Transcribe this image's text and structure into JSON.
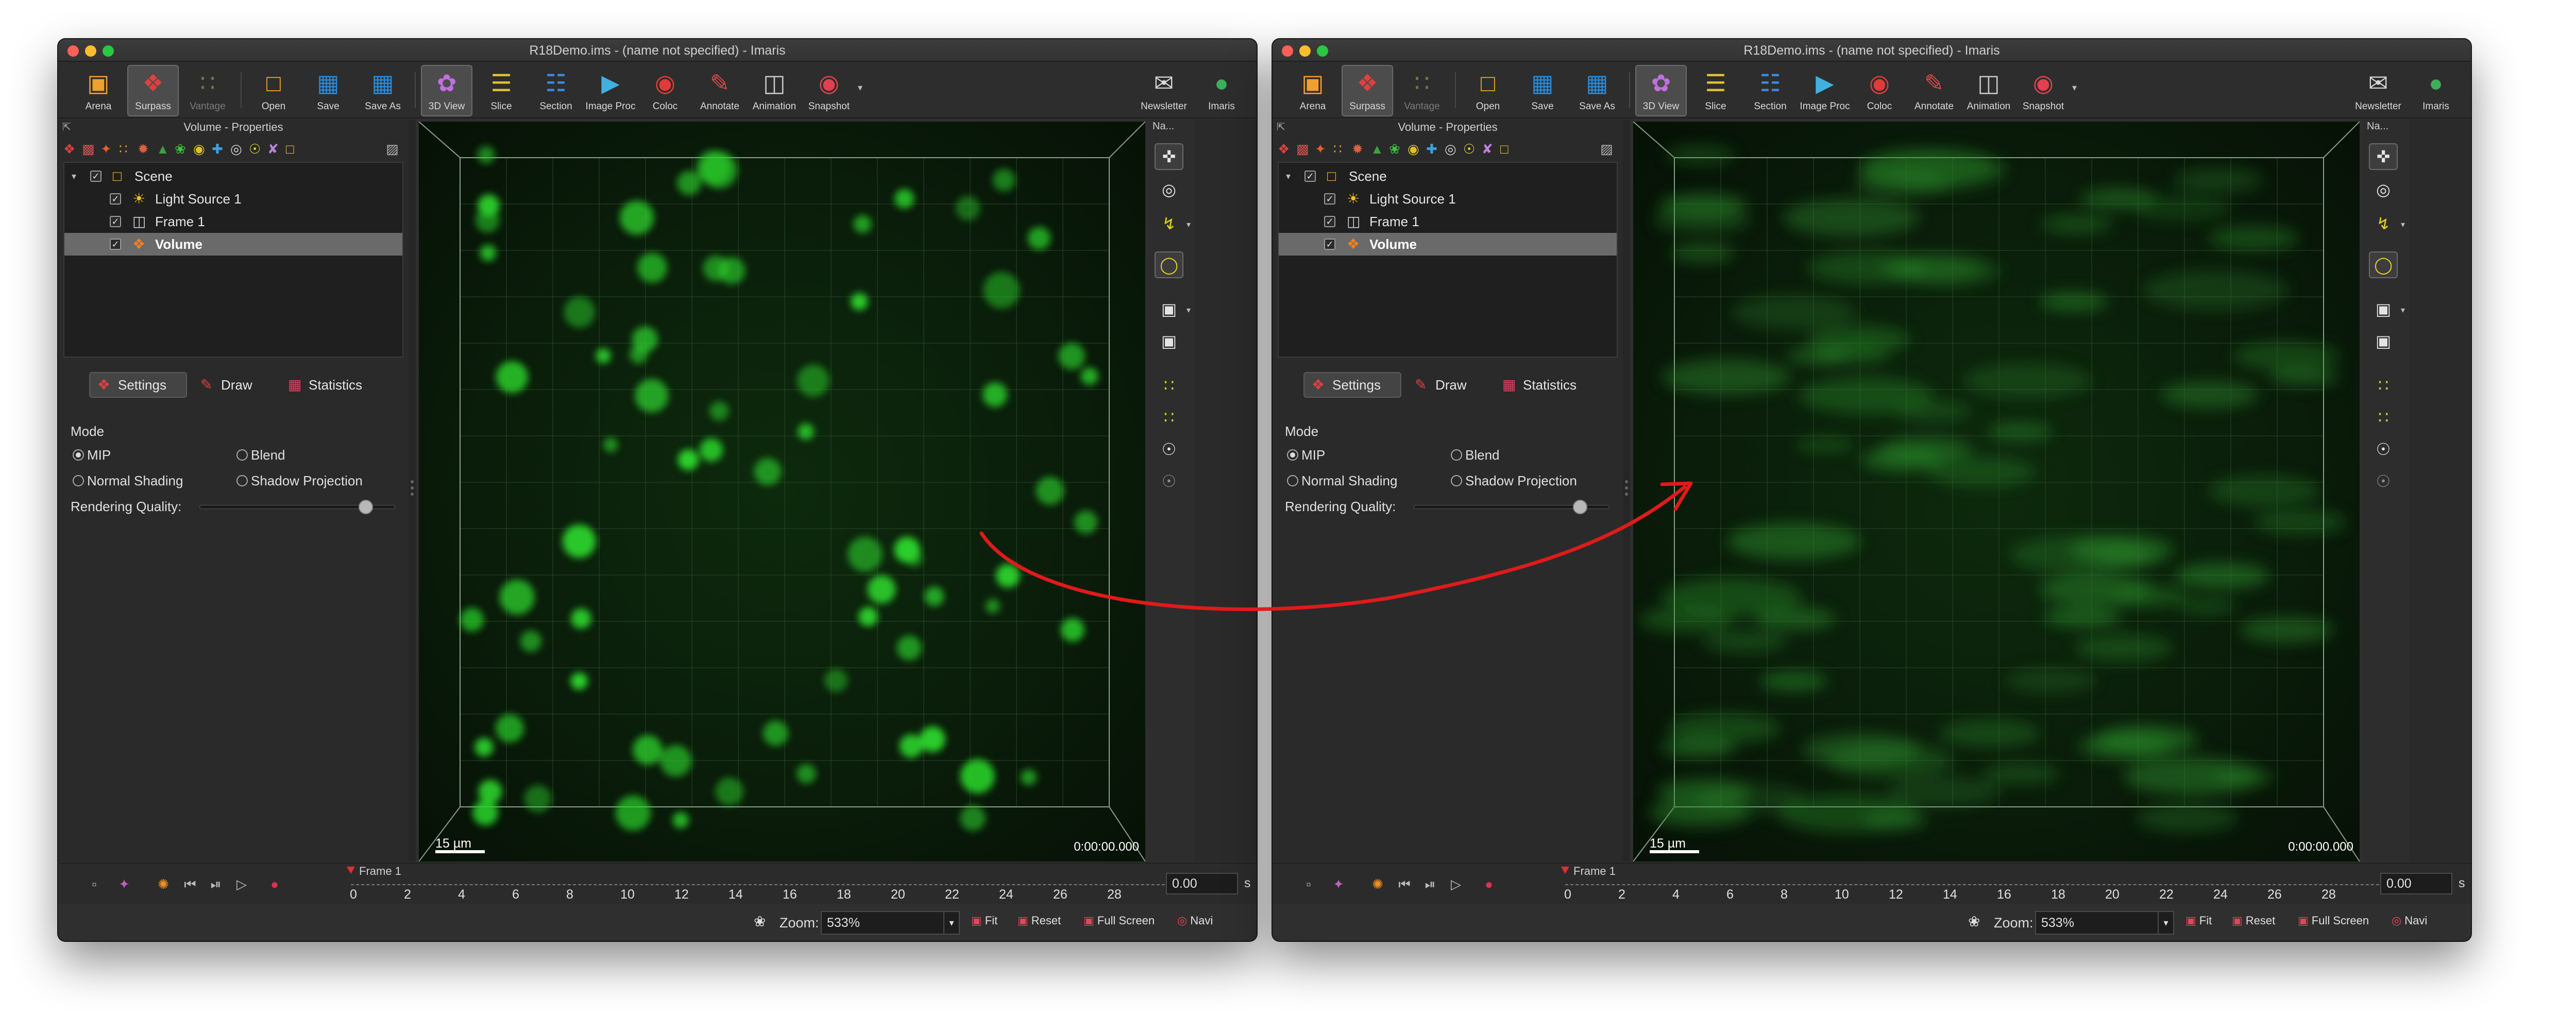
{
  "colors": {
    "accent_red": "#e01a1a",
    "spot_green": "#2bd12b",
    "window_bg": "#2f2f2f"
  },
  "windows": [
    {
      "id": "left",
      "title": "R18Demo.ims - (name not specified) - Imaris",
      "toolbar": {
        "arena": "Arena",
        "surpass": "Surpass",
        "vantage": "Vantage",
        "open": "Open",
        "save": "Save",
        "save_as": "Save As",
        "view3d": "3D View",
        "slice": "Slice",
        "section": "Section",
        "image_proc": "Image Proc",
        "coloc": "Coloc",
        "annotate": "Annotate",
        "animation": "Animation",
        "snapshot": "Snapshot",
        "newsletter": "Newsletter",
        "imaris": "Imaris"
      },
      "panel_title": "Volume - Properties",
      "navi_short": "Na...",
      "tree": [
        "Scene",
        "Light Source 1",
        "Frame 1",
        "Volume"
      ],
      "tabs": [
        "Settings",
        "Draw",
        "Statistics"
      ],
      "mode_label": "Mode",
      "modes": [
        "MIP",
        "Blend",
        "Normal Shading",
        "Shadow Projection"
      ],
      "selected_mode": "MIP",
      "rendering_quality_label": "Rendering Quality:",
      "rendering_quality": 0.85,
      "scale_bar": "15 µm",
      "time_display": "0:00:00.000",
      "timeline": {
        "frame_label": "Frame 1",
        "ticks": [
          "0",
          "2",
          "4",
          "6",
          "8",
          "10",
          "12",
          "14",
          "16",
          "18",
          "20",
          "22",
          "24",
          "26",
          "28"
        ],
        "time_value": "0.00",
        "time_unit": "s"
      },
      "status": {
        "zoom_label": "Zoom:",
        "zoom_value": "533%",
        "fit": "Fit",
        "reset": "Reset",
        "full_screen": "Full Screen",
        "navi": "Navi"
      }
    },
    {
      "id": "right",
      "title": "R18Demo.ims - (name not specified) - Imaris",
      "toolbar": {
        "arena": "Arena",
        "surpass": "Surpass",
        "vantage": "Vantage",
        "open": "Open",
        "save": "Save",
        "save_as": "Save As",
        "view3d": "3D View",
        "slice": "Slice",
        "section": "Section",
        "image_proc": "Image Proc",
        "coloc": "Coloc",
        "annotate": "Annotate",
        "animation": "Animation",
        "snapshot": "Snapshot",
        "newsletter": "Newsletter",
        "imaris": "Imaris"
      },
      "panel_title": "Volume - Properties",
      "navi_short": "Na...",
      "tree": [
        "Scene",
        "Light Source 1",
        "Frame 1",
        "Volume"
      ],
      "tabs": [
        "Settings",
        "Draw",
        "Statistics"
      ],
      "mode_label": "Mode",
      "modes": [
        "MIP",
        "Blend",
        "Normal Shading",
        "Shadow Projection"
      ],
      "selected_mode": "MIP",
      "rendering_quality_label": "Rendering Quality:",
      "rendering_quality": 0.85,
      "scale_bar": "15 µm",
      "time_display": "0:00:00.000",
      "timeline": {
        "frame_label": "Frame 1",
        "ticks": [
          "0",
          "2",
          "4",
          "6",
          "8",
          "10",
          "12",
          "14",
          "16",
          "18",
          "20",
          "22",
          "24",
          "26",
          "28"
        ],
        "time_value": "0.00",
        "time_unit": "s"
      },
      "status": {
        "zoom_label": "Zoom:",
        "zoom_value": "533%",
        "fit": "Fit",
        "reset": "Reset",
        "full_screen": "Full Screen",
        "navi": "Navi"
      }
    }
  ]
}
